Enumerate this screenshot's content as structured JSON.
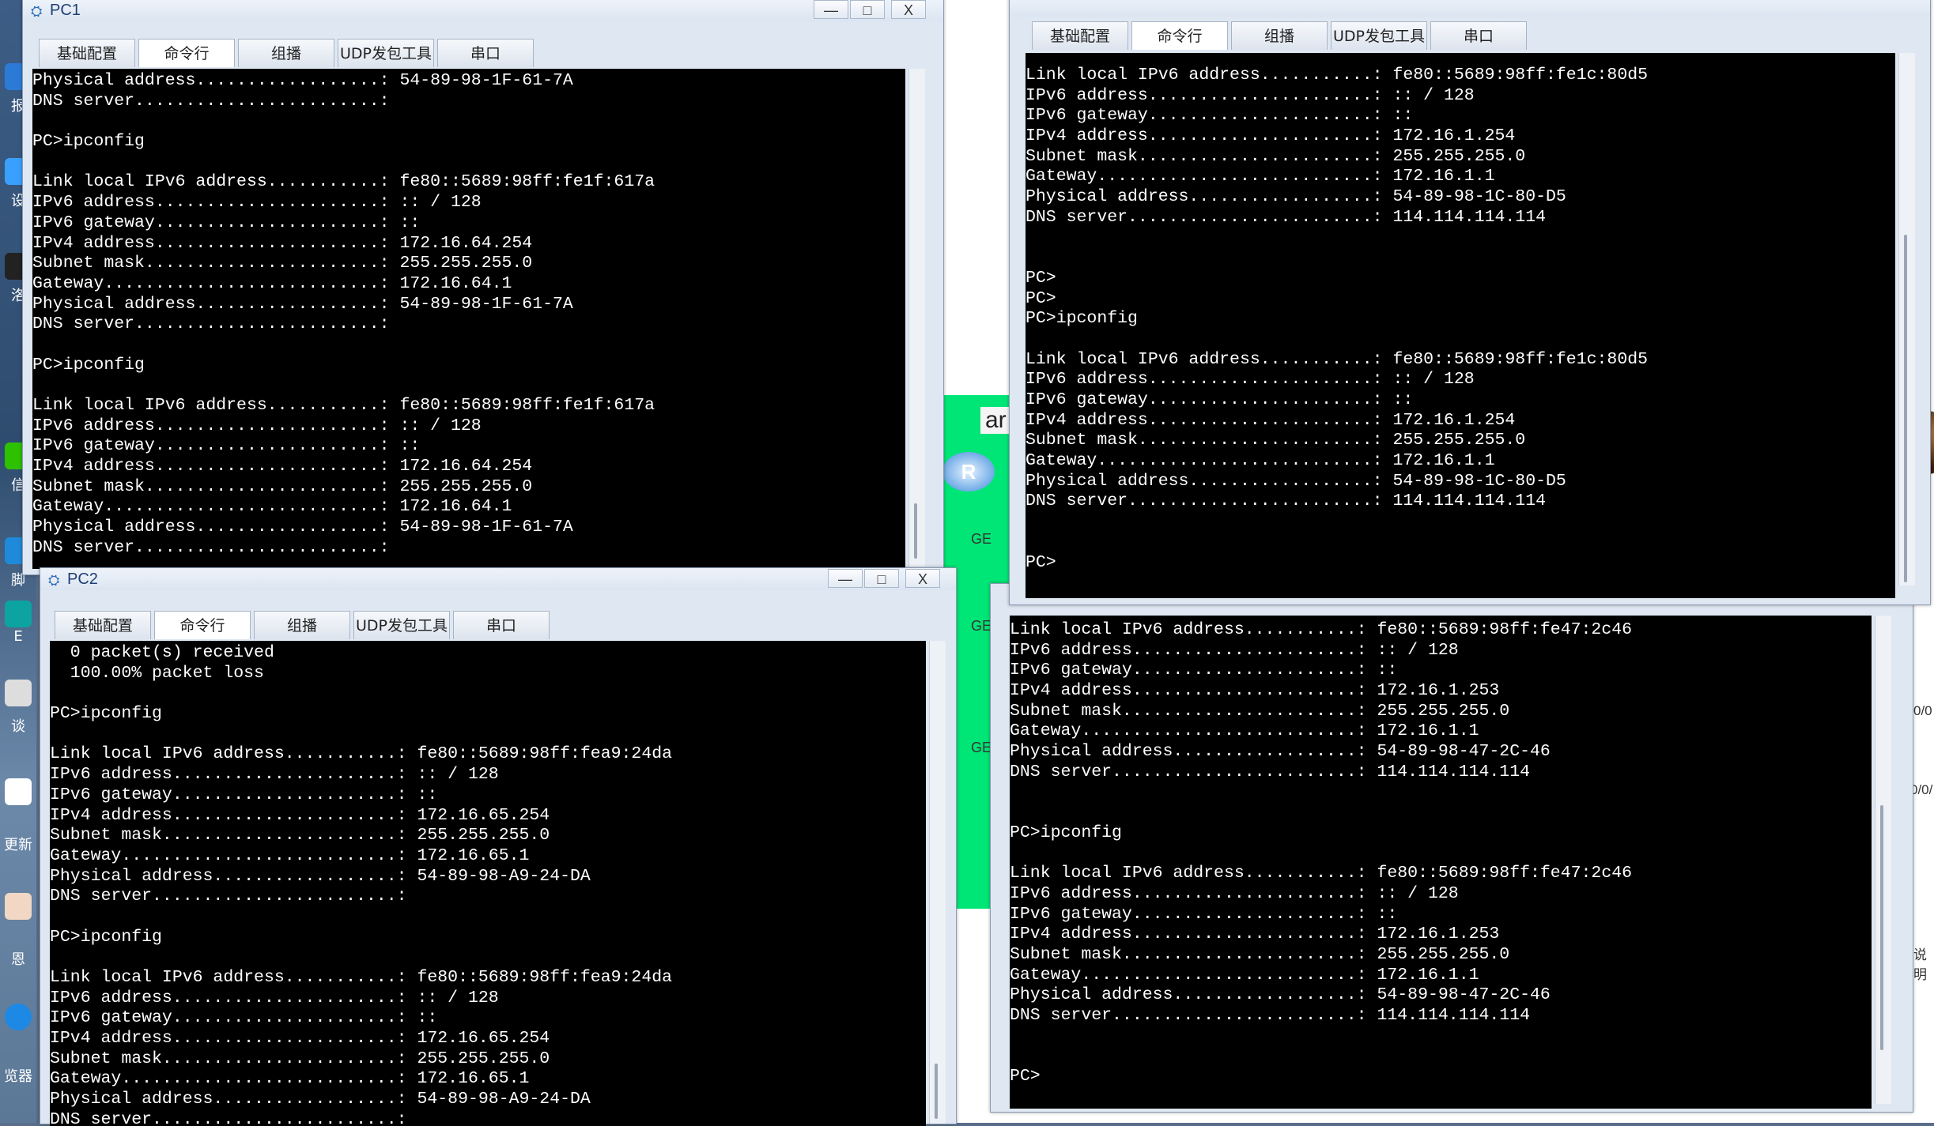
{
  "desktop": {
    "icon_labels": [
      "报",
      "设",
      "洛",
      "信",
      "脚",
      "E",
      "谈",
      "更新",
      "恩",
      "览器"
    ],
    "topology": {
      "label": "ar",
      "router_text": "R",
      "port_labels": [
        "GE",
        "GE",
        "GE"
      ],
      "right_labels": [
        "0/0",
        "0/0/",
        "说明"
      ]
    }
  },
  "tabs": [
    "基础配置",
    "命令行",
    "组播",
    "UDP发包工具",
    "串口"
  ],
  "window_controls": {
    "minimize": "—",
    "maximize": "□",
    "close": "X"
  },
  "pc1": {
    "title": "PC1",
    "lines": [
      "Physical address..................: 54-89-98-1F-61-7A",
      "DNS server........................:",
      "",
      "PC>ipconfig",
      "",
      "Link local IPv6 address...........: fe80::5689:98ff:fe1f:617a",
      "IPv6 address......................: :: / 128",
      "IPv6 gateway......................: ::",
      "IPv4 address......................: 172.16.64.254",
      "Subnet mask.......................: 255.255.255.0",
      "Gateway...........................: 172.16.64.1",
      "Physical address..................: 54-89-98-1F-61-7A",
      "DNS server........................:",
      "",
      "PC>ipconfig",
      "",
      "Link local IPv6 address...........: fe80::5689:98ff:fe1f:617a",
      "IPv6 address......................: :: / 128",
      "IPv6 gateway......................: ::",
      "IPv4 address......................: 172.16.64.254",
      "Subnet mask.......................: 255.255.255.0",
      "Gateway...........................: 172.16.64.1",
      "Physical address..................: 54-89-98-1F-61-7A",
      "DNS server........................:"
    ]
  },
  "pc2": {
    "title": "PC2",
    "lines": [
      "  0 packet(s) received",
      "  100.00% packet loss",
      "",
      "PC>ipconfig",
      "",
      "Link local IPv6 address...........: fe80::5689:98ff:fea9:24da",
      "IPv6 address......................: :: / 128",
      "IPv6 gateway......................: ::",
      "IPv4 address......................: 172.16.65.254",
      "Subnet mask.......................: 255.255.255.0",
      "Gateway...........................: 172.16.65.1",
      "Physical address..................: 54-89-98-A9-24-DA",
      "DNS server........................:",
      "",
      "PC>ipconfig",
      "",
      "Link local IPv6 address...........: fe80::5689:98ff:fea9:24da",
      "IPv6 address......................: :: / 128",
      "IPv6 gateway......................: ::",
      "IPv4 address......................: 172.16.65.254",
      "Subnet mask.......................: 255.255.255.0",
      "Gateway...........................: 172.16.65.1",
      "Physical address..................: 54-89-98-A9-24-DA",
      "DNS server........................:"
    ]
  },
  "pc3": {
    "lines": [
      "Link local IPv6 address...........: fe80::5689:98ff:fe1c:80d5",
      "IPv6 address......................: :: / 128",
      "IPv6 gateway......................: ::",
      "IPv4 address......................: 172.16.1.254",
      "Subnet mask.......................: 255.255.255.0",
      "Gateway...........................: 172.16.1.1",
      "Physical address..................: 54-89-98-1C-80-D5",
      "DNS server........................: 114.114.114.114",
      "",
      "",
      "PC>",
      "PC>",
      "PC>ipconfig",
      "",
      "Link local IPv6 address...........: fe80::5689:98ff:fe1c:80d5",
      "IPv6 address......................: :: / 128",
      "IPv6 gateway......................: ::",
      "IPv4 address......................: 172.16.1.254",
      "Subnet mask.......................: 255.255.255.0",
      "Gateway...........................: 172.16.1.1",
      "Physical address..................: 54-89-98-1C-80-D5",
      "DNS server........................: 114.114.114.114",
      "",
      "",
      "PC>"
    ]
  },
  "pc4": {
    "lines": [
      "Link local IPv6 address...........: fe80::5689:98ff:fe47:2c46",
      "IPv6 address......................: :: / 128",
      "IPv6 gateway......................: ::",
      "IPv4 address......................: 172.16.1.253",
      "Subnet mask.......................: 255.255.255.0",
      "Gateway...........................: 172.16.1.1",
      "Physical address..................: 54-89-98-47-2C-46",
      "DNS server........................: 114.114.114.114",
      "",
      "",
      "PC>ipconfig",
      "",
      "Link local IPv6 address...........: fe80::5689:98ff:fe47:2c46",
      "IPv6 address......................: :: / 128",
      "IPv6 gateway......................: ::",
      "IPv4 address......................: 172.16.1.253",
      "Subnet mask.......................: 255.255.255.0",
      "Gateway...........................: 172.16.1.1",
      "Physical address..................: 54-89-98-47-2C-46",
      "DNS server........................: 114.114.114.114",
      "",
      "",
      "PC>"
    ]
  }
}
